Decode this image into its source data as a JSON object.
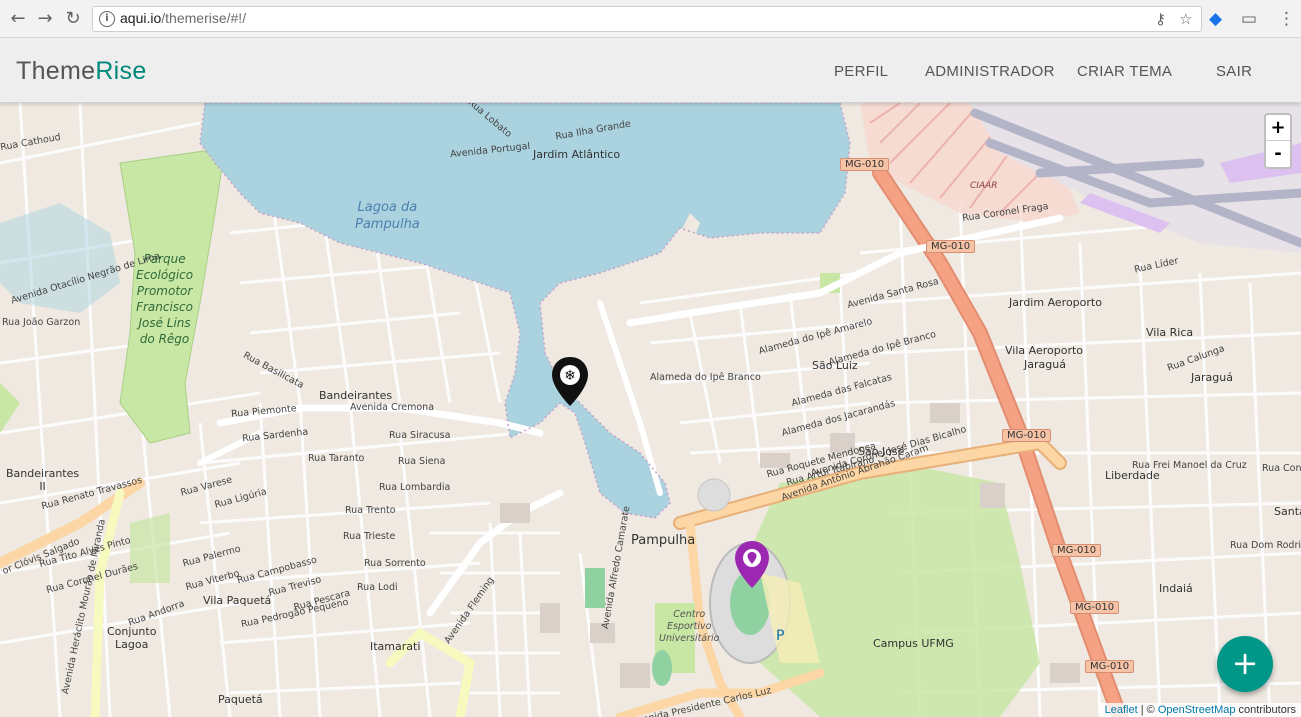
{
  "browser": {
    "url_host": "aqui.io",
    "url_path": "/themerise/#!/"
  },
  "header": {
    "brand_part1": "Theme",
    "brand_part2": "Rise",
    "menu": [
      {
        "label": "PERFIL"
      },
      {
        "label": "ADMINISTRADOR"
      },
      {
        "label": "CRIAR TEMA"
      },
      {
        "label": "SAIR"
      }
    ]
  },
  "colors": {
    "brand_accent": "#00897b",
    "fab": "#009688",
    "marker_dark": "#111111",
    "marker_purple": "#9c27b0",
    "water": "#aad3df",
    "park": "#c8e6a4",
    "highway": "#f5a284",
    "primary_road": "#fcd6a4"
  },
  "map": {
    "zoom_in": "+",
    "zoom_out": "-",
    "attribution": {
      "leaflet": "Leaflet",
      "sep": " | © ",
      "osm": "OpenStreetMap",
      "suffix": " contributors"
    },
    "labels": {
      "lagoa_1": "Lagoa da",
      "lagoa_2": "Pampulha",
      "park_1": "Parque",
      "park_2": "Ecológico",
      "park_3": "Promotor",
      "park_4": "Francisco",
      "park_5": "José Lins",
      "park_6": "do Rêgo",
      "jardim_atlantico": "Jardim Atlântico",
      "bandeirantes": "Bandeirantes",
      "bandeirantes_ii_1": "Bandeirantes",
      "bandeirantes_ii_2": "II",
      "pampulha": "Pampulha",
      "sao_luiz": "São Luiz",
      "sao_jose": "São José",
      "jardim_aeroporto": "Jardim Aeroporto",
      "vila_rica": "Vila Rica",
      "vila_aeroporto": "Vila Aeroporto",
      "jaragua": "Jaraguá",
      "jaragua2": "Jaraguá",
      "liberdade": "Liberdade",
      "campus": "Campus UFMG",
      "vila_paqueta": "Vila Paquetá",
      "conjunto_lagoa_1": "Conjunto",
      "conjunto_lagoa_2": "Lagoa",
      "itamarati": "Itamarati",
      "paqueta": "Paquetá",
      "india": "Indaiá",
      "santa": "Santa",
      "ciaar": "CIAAR",
      "centro_1": "Centro",
      "centro_2": "Esportivo",
      "centro_3": "Universitário",
      "parking": "P",
      "av_cremona": "Avenida Cremona",
      "av_abrahao": "Avenida Antônio Abrahão Caram",
      "av_portugal": "Avenida Portugal",
      "av_santa_rosa": "Avenida Santa Rosa",
      "av_presidente": "Avenida Presidente Carlos Luz",
      "av_jose_dias": "Avenida Coronel José Dias Bicalho",
      "av_fleming": "Avenida Fleming",
      "av_otacilio": "Avenida Otacílio Negrão de Lima",
      "av_heraclito": "Avenida Heráclito Mourão de Miranda",
      "av_clovis": "or Clóvis Salgado",
      "rua_sardenha": "Rua Sardenha",
      "rua_piemonte": "Rua Piemonte",
      "rua_siracusa": "Rua Siracusa",
      "rua_taranto": "Rua Taranto",
      "rua_siena": "Rua Siena",
      "rua_lombardia": "Rua Lombardia",
      "rua_trento": "Rua Trento",
      "rua_trieste": "Rua Trieste",
      "rua_sorrento": "Rua Sorrento",
      "rua_lodi": "Rua Lodi",
      "rua_varese": "Rua Varese",
      "rua_liguria": "Rua Ligúria",
      "rua_palermo": "Rua Palermo",
      "rua_viterbo": "Rua Viterbo",
      "rua_campobasso": "Rua Campobasso",
      "rua_treviso": "Rua Treviso",
      "rua_pescara": "Rua Pescara",
      "rua_pedragao": "Rua Pedrogão Pequeno",
      "rua_andorra": "Rua Andorra",
      "rua_coronel_duraes": "Rua Coronel Durães",
      "rua_tito": "Rua Tito Alves Pinto",
      "rua_renato": "Rua Renato Travassos",
      "rua_joao_garzon": "Rua João Garzon",
      "rua_basilicata": "Rua Basilicata",
      "rua_lider": "Rua Líder",
      "rua_coronel_fraga": "Rua Coronel Fraga",
      "rua_calunga": "Rua Calunga",
      "rua_frei": "Rua Frei Manoel da Cruz",
      "rua_dom": "Rua Dom Rodrigo",
      "rua_conse": "Rua Conse",
      "rua_artur": "Rua Artur Itabirano",
      "rua_roquete": "Rua Roquete Mendonça",
      "al_ipe_amarelo": "Alameda do Ipê Amarelo",
      "al_ipe_branco": "Alameda do Ipê Branco",
      "al_ipe_branco2": "Alameda do Ipê Branco",
      "al_falcatas": "Alameda das Falcatas",
      "al_jacarandas": "Alameda dos Jacarandás",
      "rua_cathoud": "Rua Cathoud",
      "rua_lobato": "Rua Lobato",
      "rua_ilha_grande": "Rua Ilha Grande",
      "av_carlos_pinto": "Avenida Alfredo Camarate",
      "mg010_a": "MG-010",
      "mg010_b": "MG-010",
      "mg010_c": "MG-010",
      "mg010_d": "MG-010",
      "mg010_e": "MG-010",
      "mg010_f": "MG-010"
    }
  }
}
